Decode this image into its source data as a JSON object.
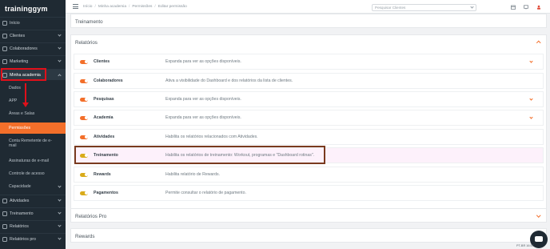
{
  "app": {
    "logo": "traininggym"
  },
  "sidebar": {
    "items": [
      {
        "label": "Início",
        "icon": "home-icon"
      },
      {
        "label": "Clientes",
        "icon": "users-icon"
      },
      {
        "label": "Colaboradores",
        "icon": "team-icon"
      },
      {
        "label": "Marketing",
        "icon": "megaphone-icon"
      },
      {
        "label": "Minha academia",
        "icon": "gym-icon"
      },
      {
        "label": "Atividades",
        "icon": "activity-icon"
      },
      {
        "label": "Treinamento",
        "icon": "dumbbell-icon"
      },
      {
        "label": "Relatórios",
        "icon": "report-icon"
      },
      {
        "label": "Relatórios pro",
        "icon": "report-pro-icon"
      }
    ],
    "sub_items": [
      "Dados",
      "APP",
      "Áreas e Salas",
      "Permissões",
      "Conta Remetente de e-mail",
      "Assinaturas de e-mail",
      "Controle de acesso",
      "Capacidade"
    ]
  },
  "topbar": {
    "crumbs": [
      "Início",
      "Minha academia",
      "Permissões",
      "Editar permissão"
    ],
    "search_placeholder": "Pesquisar Clientes"
  },
  "sections": {
    "treinamento": "Treinamento",
    "relatorios": "Relatórios",
    "relatorios_pro": "Relatórios Pro",
    "rewards": "Rewards"
  },
  "permissions": [
    {
      "name": "Clientes",
      "desc": "Expanda para ver as opções disponíveis.",
      "expandable": true,
      "toggle_color": "#f36f2a"
    },
    {
      "name": "Colaboradores",
      "desc": "Ativa a visibilidade do Dashboard e dos relatórios da lista de clientes.",
      "expandable": false,
      "toggle_color": "#f36f2a"
    },
    {
      "name": "Pesquisas",
      "desc": "Expanda para ver as opções disponíveis.",
      "expandable": true,
      "toggle_color": "#f36f2a"
    },
    {
      "name": "Academia",
      "desc": "Expanda para ver as opções disponíveis.",
      "expandable": true,
      "toggle_color": "#f36f2a"
    },
    {
      "name": "Atividades",
      "desc": "Habilita os relatórios relacionados com Atividades.",
      "expandable": false,
      "toggle_color": "#f36f2a"
    },
    {
      "name": "Treinamento",
      "desc": "Habilita os relatórios de treinamento: Workout, programas e \"Dashboard rotinas\".",
      "expandable": false,
      "toggle_color": "#d9ab1a"
    },
    {
      "name": "Rewards",
      "desc": "Habilita relatório de Rewards.",
      "expandable": false,
      "toggle_color": "#d9ab1a"
    },
    {
      "name": "Pagamentos",
      "desc": "Permite consultar o relatório de pagamento.",
      "expandable": false,
      "toggle_color": "#d9ab1a"
    }
  ],
  "statusbar": {
    "text": "PT-BR  16:57"
  },
  "colors": {
    "accent": "#f36f2a",
    "sidebar_bg": "#1f2a33",
    "annotation_red": "#e0101a",
    "annotation_brown": "#7a3a1f"
  }
}
